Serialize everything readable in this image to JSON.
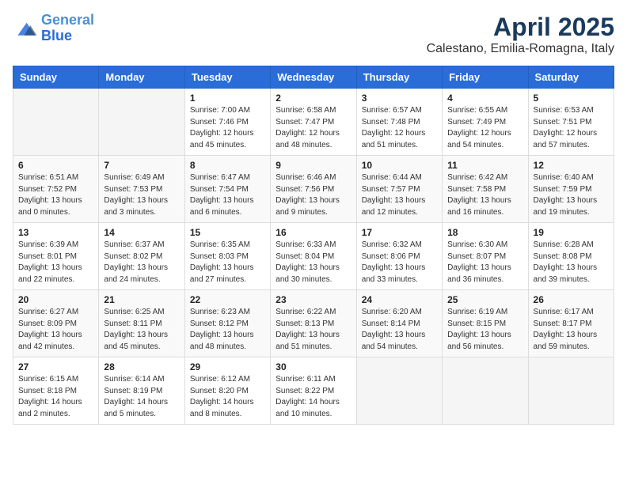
{
  "header": {
    "logo_line1": "General",
    "logo_line2": "Blue",
    "month": "April 2025",
    "location": "Calestano, Emilia-Romagna, Italy"
  },
  "weekdays": [
    "Sunday",
    "Monday",
    "Tuesday",
    "Wednesday",
    "Thursday",
    "Friday",
    "Saturday"
  ],
  "weeks": [
    [
      {
        "day": "",
        "info": ""
      },
      {
        "day": "",
        "info": ""
      },
      {
        "day": "1",
        "info": "Sunrise: 7:00 AM\nSunset: 7:46 PM\nDaylight: 12 hours\nand 45 minutes."
      },
      {
        "day": "2",
        "info": "Sunrise: 6:58 AM\nSunset: 7:47 PM\nDaylight: 12 hours\nand 48 minutes."
      },
      {
        "day": "3",
        "info": "Sunrise: 6:57 AM\nSunset: 7:48 PM\nDaylight: 12 hours\nand 51 minutes."
      },
      {
        "day": "4",
        "info": "Sunrise: 6:55 AM\nSunset: 7:49 PM\nDaylight: 12 hours\nand 54 minutes."
      },
      {
        "day": "5",
        "info": "Sunrise: 6:53 AM\nSunset: 7:51 PM\nDaylight: 12 hours\nand 57 minutes."
      }
    ],
    [
      {
        "day": "6",
        "info": "Sunrise: 6:51 AM\nSunset: 7:52 PM\nDaylight: 13 hours\nand 0 minutes."
      },
      {
        "day": "7",
        "info": "Sunrise: 6:49 AM\nSunset: 7:53 PM\nDaylight: 13 hours\nand 3 minutes."
      },
      {
        "day": "8",
        "info": "Sunrise: 6:47 AM\nSunset: 7:54 PM\nDaylight: 13 hours\nand 6 minutes."
      },
      {
        "day": "9",
        "info": "Sunrise: 6:46 AM\nSunset: 7:56 PM\nDaylight: 13 hours\nand 9 minutes."
      },
      {
        "day": "10",
        "info": "Sunrise: 6:44 AM\nSunset: 7:57 PM\nDaylight: 13 hours\nand 12 minutes."
      },
      {
        "day": "11",
        "info": "Sunrise: 6:42 AM\nSunset: 7:58 PM\nDaylight: 13 hours\nand 16 minutes."
      },
      {
        "day": "12",
        "info": "Sunrise: 6:40 AM\nSunset: 7:59 PM\nDaylight: 13 hours\nand 19 minutes."
      }
    ],
    [
      {
        "day": "13",
        "info": "Sunrise: 6:39 AM\nSunset: 8:01 PM\nDaylight: 13 hours\nand 22 minutes."
      },
      {
        "day": "14",
        "info": "Sunrise: 6:37 AM\nSunset: 8:02 PM\nDaylight: 13 hours\nand 24 minutes."
      },
      {
        "day": "15",
        "info": "Sunrise: 6:35 AM\nSunset: 8:03 PM\nDaylight: 13 hours\nand 27 minutes."
      },
      {
        "day": "16",
        "info": "Sunrise: 6:33 AM\nSunset: 8:04 PM\nDaylight: 13 hours\nand 30 minutes."
      },
      {
        "day": "17",
        "info": "Sunrise: 6:32 AM\nSunset: 8:06 PM\nDaylight: 13 hours\nand 33 minutes."
      },
      {
        "day": "18",
        "info": "Sunrise: 6:30 AM\nSunset: 8:07 PM\nDaylight: 13 hours\nand 36 minutes."
      },
      {
        "day": "19",
        "info": "Sunrise: 6:28 AM\nSunset: 8:08 PM\nDaylight: 13 hours\nand 39 minutes."
      }
    ],
    [
      {
        "day": "20",
        "info": "Sunrise: 6:27 AM\nSunset: 8:09 PM\nDaylight: 13 hours\nand 42 minutes."
      },
      {
        "day": "21",
        "info": "Sunrise: 6:25 AM\nSunset: 8:11 PM\nDaylight: 13 hours\nand 45 minutes."
      },
      {
        "day": "22",
        "info": "Sunrise: 6:23 AM\nSunset: 8:12 PM\nDaylight: 13 hours\nand 48 minutes."
      },
      {
        "day": "23",
        "info": "Sunrise: 6:22 AM\nSunset: 8:13 PM\nDaylight: 13 hours\nand 51 minutes."
      },
      {
        "day": "24",
        "info": "Sunrise: 6:20 AM\nSunset: 8:14 PM\nDaylight: 13 hours\nand 54 minutes."
      },
      {
        "day": "25",
        "info": "Sunrise: 6:19 AM\nSunset: 8:15 PM\nDaylight: 13 hours\nand 56 minutes."
      },
      {
        "day": "26",
        "info": "Sunrise: 6:17 AM\nSunset: 8:17 PM\nDaylight: 13 hours\nand 59 minutes."
      }
    ],
    [
      {
        "day": "27",
        "info": "Sunrise: 6:15 AM\nSunset: 8:18 PM\nDaylight: 14 hours\nand 2 minutes."
      },
      {
        "day": "28",
        "info": "Sunrise: 6:14 AM\nSunset: 8:19 PM\nDaylight: 14 hours\nand 5 minutes."
      },
      {
        "day": "29",
        "info": "Sunrise: 6:12 AM\nSunset: 8:20 PM\nDaylight: 14 hours\nand 8 minutes."
      },
      {
        "day": "30",
        "info": "Sunrise: 6:11 AM\nSunset: 8:22 PM\nDaylight: 14 hours\nand 10 minutes."
      },
      {
        "day": "",
        "info": ""
      },
      {
        "day": "",
        "info": ""
      },
      {
        "day": "",
        "info": ""
      }
    ]
  ]
}
